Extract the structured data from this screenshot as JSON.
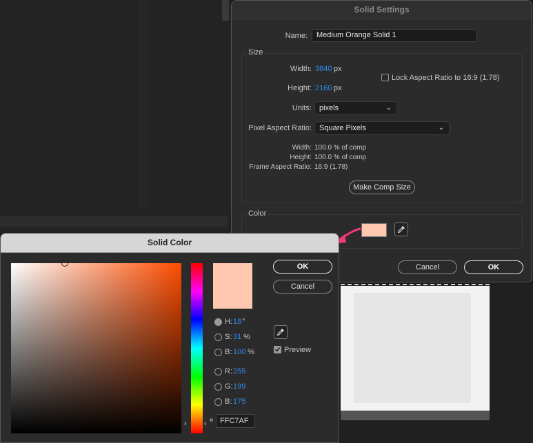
{
  "solid_settings": {
    "title": "Solid Settings",
    "name_label": "Name:",
    "name_value": "Medium Orange Solid 1",
    "size_group": "Size",
    "width_label": "Width:",
    "width_value": "3840",
    "width_unit": "px",
    "height_label": "Height:",
    "height_value": "2160",
    "height_unit": "px",
    "lock_aspect_label": "Lock Aspect Ratio to 16:9 (1.78)",
    "units_label": "Units:",
    "units_value": "pixels",
    "par_label": "Pixel Aspect Ratio:",
    "par_value": "Square Pixels",
    "info_width_label": "Width:",
    "info_width_value": "100.0 % of comp",
    "info_height_label": "Height:",
    "info_height_value": "100.0 % of comp",
    "info_far_label": "Frame Aspect Ratio:",
    "info_far_value": "16:9 (1.78)",
    "make_comp_size": "Make Comp Size",
    "color_group": "Color",
    "cancel": "Cancel",
    "ok": "OK"
  },
  "solid_color": {
    "title": "Solid Color",
    "ok": "OK",
    "cancel": "Cancel",
    "h_label": "H:",
    "h_value": "18",
    "h_unit": "°",
    "s_label": "S:",
    "s_value": "31",
    "s_unit": "%",
    "b_label": "B:",
    "b_value": "100",
    "b_unit": "%",
    "r_label": "R:",
    "r_value": "255",
    "g_label": "G:",
    "g_value": "199",
    "b2_label": "B:",
    "b2_value": "175",
    "hash": "#",
    "hex_value": "FFC7AF",
    "preview_label": "Preview"
  },
  "colors": {
    "swatch": "#FFC7AF",
    "accent_blue": "#2D8CEB",
    "arrow": "#F0387A"
  }
}
